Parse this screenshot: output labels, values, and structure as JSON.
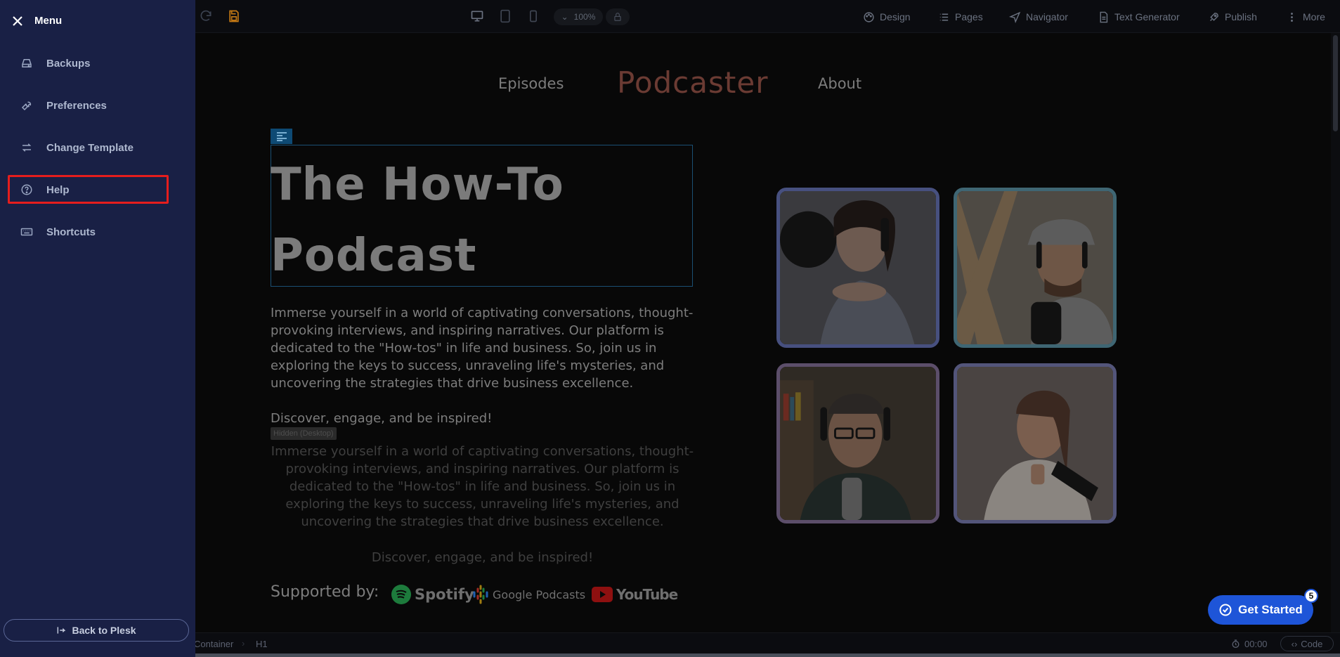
{
  "toolbar": {
    "zoom": "100%",
    "items": [
      {
        "label": "Design",
        "icon": "palette-icon"
      },
      {
        "label": "Pages",
        "icon": "list-icon"
      },
      {
        "label": "Navigator",
        "icon": "navigation-arrow-icon"
      },
      {
        "label": "Text Generator",
        "icon": "document-icon"
      },
      {
        "label": "Publish",
        "icon": "rocket-icon"
      },
      {
        "label": "More",
        "icon": "vertical-dots-icon"
      }
    ]
  },
  "site": {
    "nav": {
      "left": "Episodes",
      "brand": "Podcaster",
      "right": "About"
    },
    "heading_line1": "The How-To",
    "heading_line2": "Podcast",
    "intro": "Immerse yourself in a world of captivating conversations, thought-provoking interviews, and inspiring narratives. Our platform is dedicated to the \"How-tos\" in life and business. So, join us in exploring the keys to success, unraveling life's mysteries, and uncovering the strategies that drive business excellence.",
    "tagline": "Discover, engage, and be inspired!",
    "hidden_badge": "Hidden (Desktop)",
    "intro_hidden": "Immerse yourself in a world of captivating conversations, thought-provoking interviews, and inspiring narratives. Our platform is dedicated to the \"How-tos\" in life and business. So, join us in exploring the keys to success, unraveling life's mysteries, and uncovering the strategies that drive business excellence.",
    "tagline_hidden": "Discover, engage, and be inspired!",
    "supported_by": "Supported by:",
    "logos": {
      "spotify": "Spotify",
      "google_podcasts": "Google Podcasts",
      "youtube": "YouTube"
    }
  },
  "get_started": {
    "label": "Get Started",
    "count": "5"
  },
  "statusbar": {
    "crumb1": "Container",
    "crumb2": "H1",
    "timer": "00:00",
    "code": "Code"
  },
  "menu": {
    "title": "Menu",
    "items": [
      {
        "label": "Backups",
        "icon": "drive-icon"
      },
      {
        "label": "Preferences",
        "icon": "wrench-icon"
      },
      {
        "label": "Change Template",
        "icon": "swap-icon"
      },
      {
        "label": "Help",
        "icon": "help-circle-icon"
      },
      {
        "label": "Shortcuts",
        "icon": "keyboard-icon"
      }
    ],
    "back": "Back to Plesk"
  },
  "colors": {
    "sidebar": "#192045",
    "accent": "#1e55d8",
    "highlight": "#e51d1d",
    "brand": "#6b3b33"
  }
}
